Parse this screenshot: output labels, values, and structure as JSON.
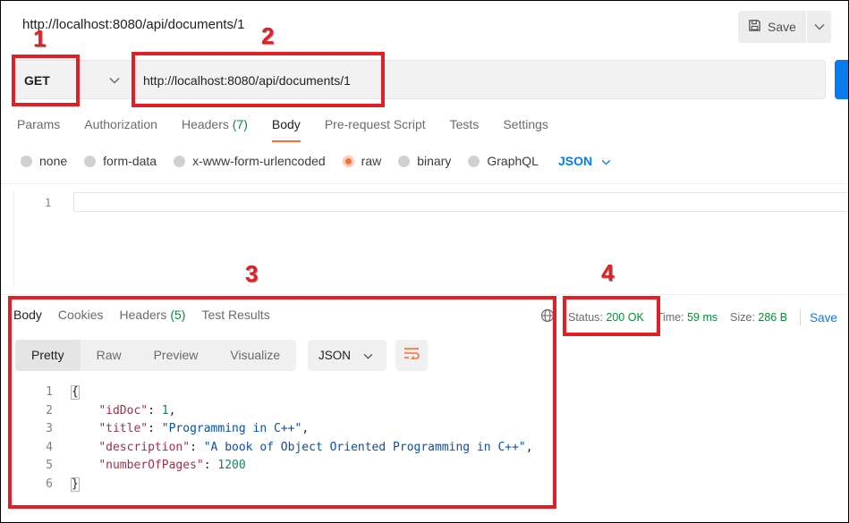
{
  "header": {
    "request_title": "http://localhost:8080/api/documents/1",
    "save_label": "Save"
  },
  "request": {
    "method": "GET",
    "url": "http://localhost:8080/api/documents/1"
  },
  "request_tabs": [
    {
      "label": "Params"
    },
    {
      "label": "Authorization"
    },
    {
      "label": "Headers",
      "count": "(7)"
    },
    {
      "label": "Body",
      "active": true
    },
    {
      "label": "Pre-request Script"
    },
    {
      "label": "Tests"
    },
    {
      "label": "Settings"
    }
  ],
  "body_types": [
    "none",
    "form-data",
    "x-www-form-urlencoded",
    "raw",
    "binary",
    "GraphQL"
  ],
  "body_type_selected": "raw",
  "body_format": "JSON",
  "request_editor": {
    "line_numbers": [
      "1"
    ]
  },
  "response_tabs": [
    {
      "label": "Body",
      "active": true
    },
    {
      "label": "Cookies"
    },
    {
      "label": "Headers",
      "count": "(5)"
    },
    {
      "label": "Test Results"
    }
  ],
  "response_status": {
    "status_label": "Status:",
    "status_value": "200 OK",
    "time_label": "Time:",
    "time_value": "59 ms",
    "size_label": "Size:",
    "size_value": "286 B",
    "save_response": "Save"
  },
  "view_modes": [
    "Pretty",
    "Raw",
    "Preview",
    "Visualize"
  ],
  "view_mode_selected": "Pretty",
  "response_format": "JSON",
  "response_lines": [
    {
      "n": "1",
      "open": "{"
    },
    {
      "n": "2",
      "key": "\"idDoc\"",
      "sep": ": ",
      "value": "1",
      "type": "num",
      "end": ","
    },
    {
      "n": "3",
      "key": "\"title\"",
      "sep": ": ",
      "value": "\"Programming in C++\"",
      "type": "str",
      "end": ","
    },
    {
      "n": "4",
      "key": "\"description\"",
      "sep": ": ",
      "value": "\"A book of Object Oriented Programming in C++\"",
      "type": "str",
      "end": ","
    },
    {
      "n": "5",
      "key": "\"numberOfPages\"",
      "sep": ": ",
      "value": "1200",
      "type": "num",
      "end": ""
    },
    {
      "n": "6",
      "close": "}"
    }
  ],
  "annotations": [
    "1",
    "2",
    "3",
    "4"
  ],
  "colors": {
    "annotation": "#e01f26",
    "accent_orange": "#ff6c37",
    "link_blue": "#097bed",
    "status_green": "#0b8a3a"
  }
}
